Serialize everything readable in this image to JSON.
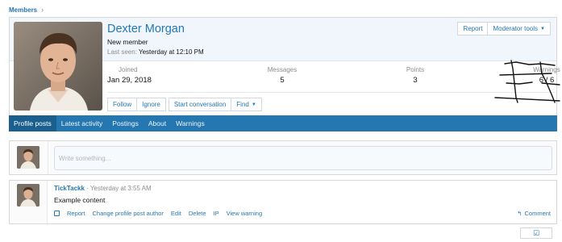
{
  "breadcrumb": {
    "label": "Members",
    "chevron": "›"
  },
  "profile": {
    "name": "Dexter Morgan",
    "user_title": "New member",
    "last_seen_label": "Last seen:",
    "last_seen_value": "Yesterday at 12:10 PM",
    "avatar": "portrait-photo"
  },
  "top_actions": {
    "report": "Report",
    "moderator_tools": "Moderator tools"
  },
  "stats": [
    {
      "label": "Joined",
      "value": "Jan 29, 2018"
    },
    {
      "label": "Messages",
      "value": "5"
    },
    {
      "label": "Points",
      "value": "3"
    },
    {
      "label": "Warnings",
      "value": "6 / 6"
    }
  ],
  "actions": {
    "follow": "Follow",
    "ignore": "Ignore",
    "start_conversation": "Start conversation",
    "find": "Find"
  },
  "tabs": [
    "Profile posts",
    "Latest activity",
    "Postings",
    "About",
    "Warnings"
  ],
  "composer": {
    "placeholder": "Write something..."
  },
  "post": {
    "author": "TickTackk",
    "time": "· Yesterday at 3:55 AM",
    "content": "Example content",
    "actions": [
      "Report",
      "Change profile post author",
      "Edit",
      "Delete",
      "IP",
      "View warning"
    ],
    "comment": "Comment"
  },
  "colors": {
    "accent": "#2577b1",
    "tab_bar": "#2577b1",
    "header_bg": "#f0f6fc"
  }
}
